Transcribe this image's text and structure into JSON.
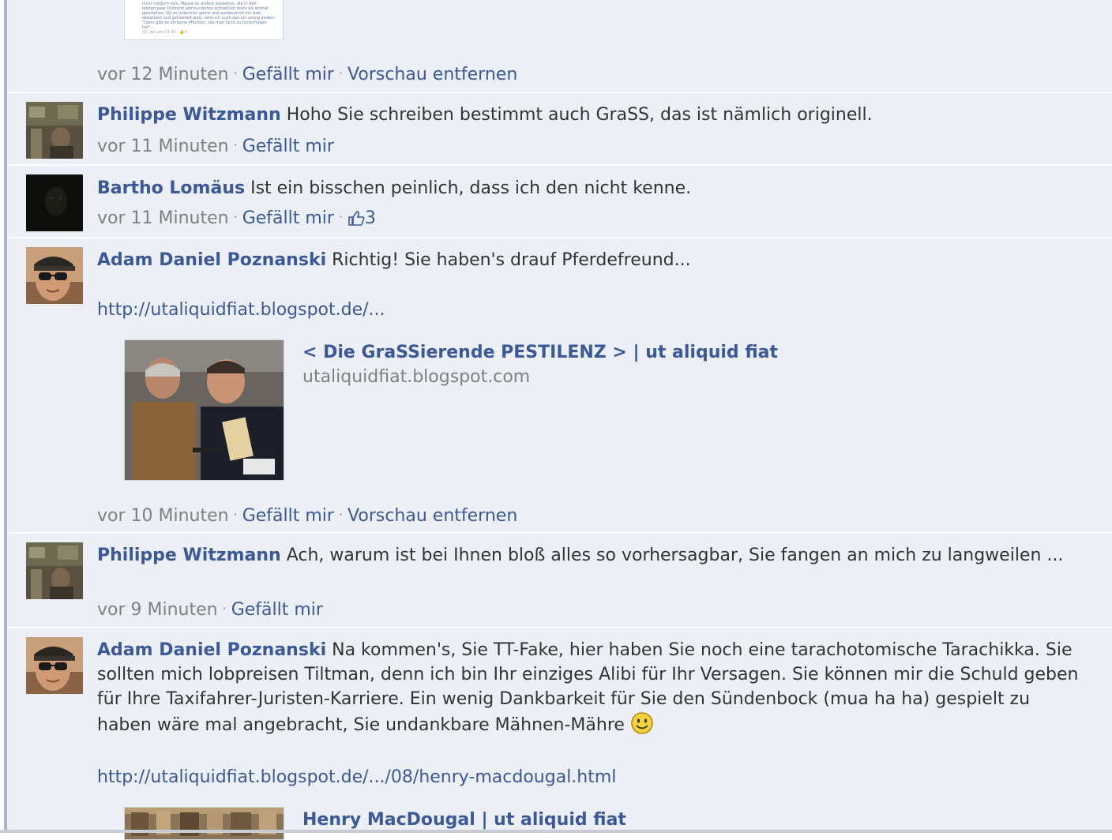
{
  "colors": {
    "link": "#3b5998",
    "meta": "#808080",
    "background": "#eceff5"
  },
  "top_comment": {
    "preview_excerpt": [
      "nicht möglich sein, Mäuse zu anders aussehen, die in den",
      "letzten paar Dutzend Jahrhunderten schließlich mehr als einmal",
      "geschehen. Da es Judentum genre und ausdauernd mir bzw.",
      "debattiert und gehandelt wird, sehe ich auch das ein wenig anders.",
      "\"Dann gibt es einfache Pflichten, die man nicht zu hinterfragen",
      "hat\"..."
    ],
    "preview_footer": "15. Juli um 03:36 · ",
    "preview_footer_like": "👍3",
    "time": "vor 12 Minuten",
    "like": "Gefällt mir",
    "remove_preview": "Vorschau entfernen"
  },
  "comments": [
    {
      "author": "Philippe Witzmann",
      "text": "Hoho Sie schreiben bestimmt auch GraSS, das ist nämlich originell.",
      "time": "vor 11 Minuten",
      "like": "Gefällt mir"
    },
    {
      "author": "Bartho Lomäus",
      "text": "Ist ein bisschen peinlich, dass ich den nicht kenne.",
      "time": "vor 11 Minuten",
      "like": "Gefällt mir",
      "like_icon": "thumbs-up-icon",
      "like_count": "3"
    },
    {
      "author": "Adam Daniel Poznanski",
      "text": "Richtig! Sie haben's drauf Pferdefreund...",
      "url": "http://utaliquidfiat.blogspot.de/...",
      "preview_title": "< Die GraSSierende PESTILENZ > | ut aliquid fiat",
      "preview_domain": "utaliquidfiat.blogspot.com",
      "time": "vor 10 Minuten",
      "like": "Gefällt mir",
      "remove_preview": "Vorschau entfernen"
    },
    {
      "author": "Philippe Witzmann",
      "text": "Ach, warum ist bei Ihnen bloß alles so vorhersagbar, Sie fangen an mich zu langweilen ...",
      "time": "vor 9 Minuten",
      "like": "Gefällt mir"
    },
    {
      "author": "Adam Daniel Poznanski",
      "text": "Na kommen's, Sie TT-Fake, hier haben Sie noch eine tarachotomische Tarachikka. Sie sollten mich lobpreisen Tiltman, denn ich bin Ihr einziges Alibi für Ihr Versagen. Sie können mir die Schuld geben für Ihre Taxifahrer-Juristen-Karriere. Ein wenig Dankbarkeit für Sie den Sündenbock (mua ha ha) gespielt zu haben wäre mal angebracht, Sie undankbare Mähnen-Mähre",
      "emoticon": "smiley-icon",
      "url": "http://utaliquidfiat.blogspot.de/.../08/henry-macdougal.html",
      "preview_title": "Henry MacDougal | ut aliquid fiat"
    }
  ]
}
